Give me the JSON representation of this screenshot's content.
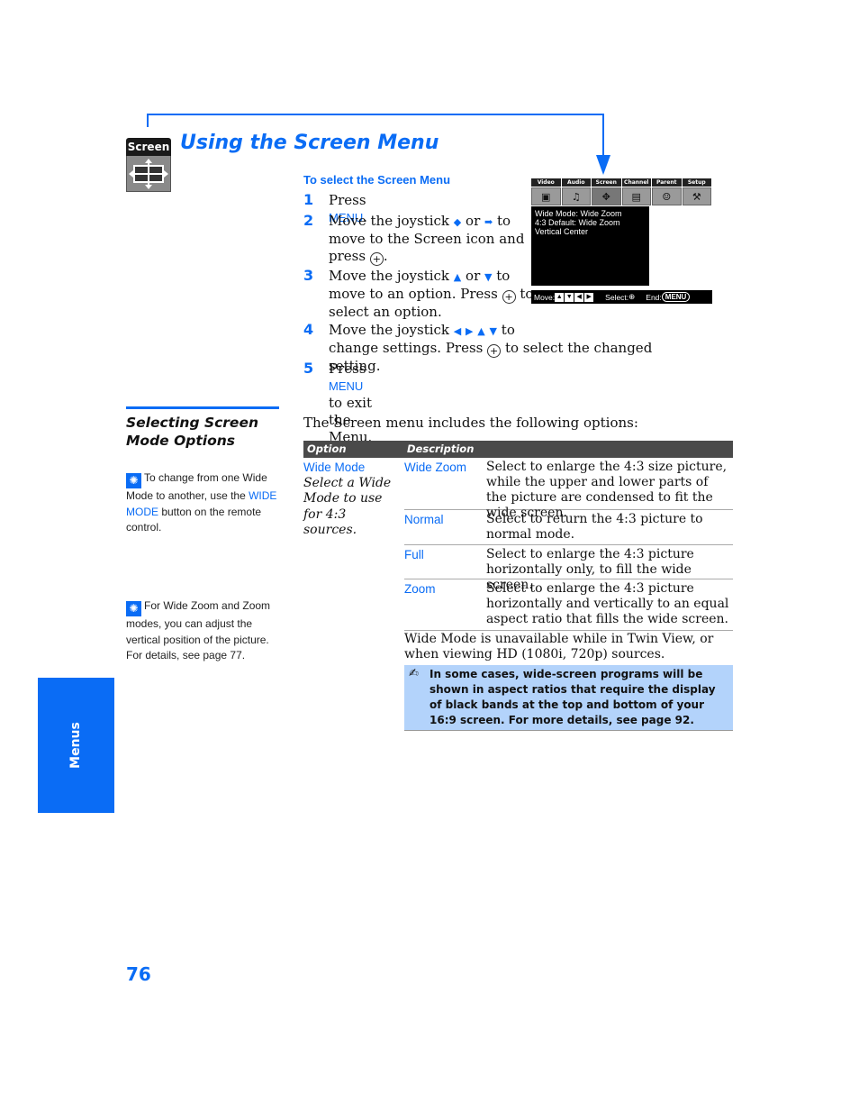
{
  "header": {
    "title": "Using the Screen Menu",
    "icon_label": "Screen"
  },
  "steps": {
    "heading": "To select the Screen Menu",
    "items": [
      {
        "num": "1",
        "parts": [
          "Press ",
          "MENU",
          "."
        ]
      },
      {
        "num": "2",
        "line1": "Move the joystick",
        "or": "or",
        "to": "to",
        "line2": "move to the Screen icon and",
        "line3": "press"
      },
      {
        "num": "3",
        "line1": "Move the joystick",
        "or": "or",
        "to": "to",
        "line2a": "move to an option. Press",
        "line2b": "to",
        "line3": "select an option."
      },
      {
        "num": "4",
        "line1": "Move the joystick",
        "to": "to",
        "line2a": "change settings. Press",
        "line2b": "to select the changed setting."
      },
      {
        "num": "5",
        "pre": "Press ",
        "key": "MENU",
        "post": " to exit the Menu."
      }
    ]
  },
  "tv_menu": {
    "tabs": [
      "Video",
      "Audio",
      "Screen",
      "Channel",
      "Parent",
      "Setup"
    ],
    "selected_tab": "Screen",
    "screen_lines": [
      "Wide Mode: Wide Zoom",
      "4:3 Default: Wide Zoom",
      "Vertical Center"
    ],
    "bar": {
      "move": "Move:",
      "select": "Select:",
      "end": "End:",
      "menu_key": "MENU"
    }
  },
  "section": {
    "title": "Selecting Screen Mode Options",
    "intro": "The Screen menu includes the following options:"
  },
  "tips": [
    {
      "pre": "To change from one Wide Mode to another, use the ",
      "key": "WIDE MODE",
      "post": " button on the remote control."
    },
    {
      "text": "For Wide Zoom and Zoom modes, you can adjust the vertical position of the picture. For details, see page 77."
    }
  ],
  "table": {
    "headers": [
      "Option",
      "Description"
    ],
    "option": {
      "name": "Wide Mode",
      "description": "Select a Wide Mode to use for 4:3 sources."
    },
    "rows": [
      {
        "name": "Wide Zoom",
        "description": "Select to enlarge the 4:3 size picture, while the upper and lower parts of the picture are condensed to fit the wide screen."
      },
      {
        "name": "Normal",
        "description": "Select to return the 4:3 picture to normal mode."
      },
      {
        "name": "Full",
        "description": "Select to enlarge the 4:3 picture horizontally only, to fill the wide screen."
      },
      {
        "name": "Zoom",
        "description": "Select to enlarge the 4:3 picture horizontally and vertically to an equal aspect ratio that fills the wide screen."
      }
    ],
    "unavailable_note": "Wide Mode is unavailable while in Twin View, or when viewing HD (1080i, 720p) sources.",
    "note": "In some cases, wide-screen programs will be shown in aspect ratios that require the display of black bands at the top and bottom of your 16:9 screen. For more details, see page 92."
  },
  "side_tab": {
    "label": "Menus"
  },
  "page_number": "76",
  "colors": {
    "accent": "#0a6cf5",
    "table_header": "#4a4a4a",
    "note_bg": "#b3d3fb"
  }
}
